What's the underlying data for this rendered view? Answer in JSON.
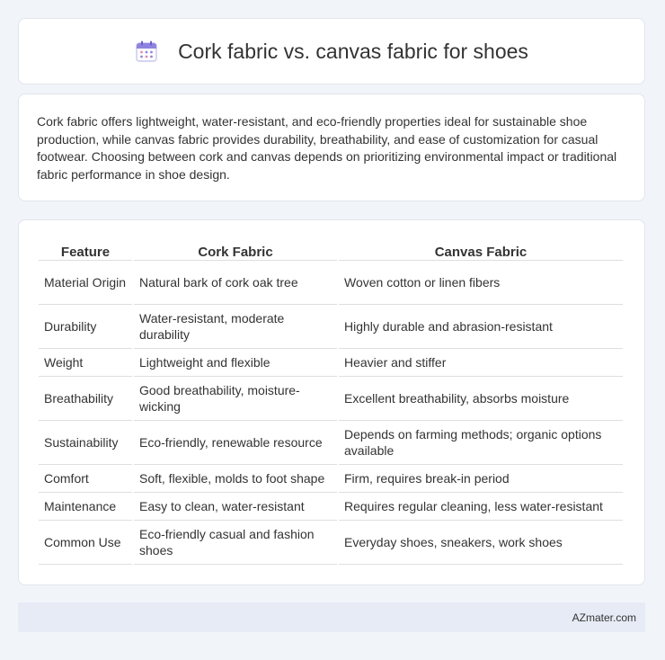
{
  "header": {
    "title": "Cork fabric vs. canvas fabric for shoes",
    "icon": "calendar-icon"
  },
  "summary": {
    "text": "Cork fabric offers lightweight, water-resistant, and eco-friendly properties ideal for sustainable shoe production, while canvas fabric provides durability, breathability, and ease of customization for casual footwear. Choosing between cork and canvas depends on prioritizing environmental impact or traditional fabric performance in shoe design."
  },
  "table": {
    "headers": [
      "Feature",
      "Cork Fabric",
      "Canvas Fabric"
    ],
    "rows": [
      [
        "Material Origin",
        "Natural bark of cork oak tree",
        "Woven cotton or linen fibers"
      ],
      [
        "Durability",
        "Water-resistant, moderate durability",
        "Highly durable and abrasion-resistant"
      ],
      [
        "Weight",
        "Lightweight and flexible",
        "Heavier and stiffer"
      ],
      [
        "Breathability",
        "Good breathability, moisture-wicking",
        "Excellent breathability, absorbs moisture"
      ],
      [
        "Sustainability",
        "Eco-friendly, renewable resource",
        "Depends on farming methods; organic options available"
      ],
      [
        "Comfort",
        "Soft, flexible, molds to foot shape",
        "Firm, requires break-in period"
      ],
      [
        "Maintenance",
        "Easy to clean, water-resistant",
        "Requires regular cleaning, less water-resistant"
      ],
      [
        "Common Use",
        "Eco-friendly casual and fashion shoes",
        "Everyday shoes, sneakers, work shoes"
      ]
    ]
  },
  "footer": {
    "brand": "AZmater.com"
  },
  "colors": {
    "background": "#f1f4f9",
    "card": "#ffffff",
    "footer_bg": "#e6ebf5",
    "icon_accent": "#7b6fd6"
  }
}
